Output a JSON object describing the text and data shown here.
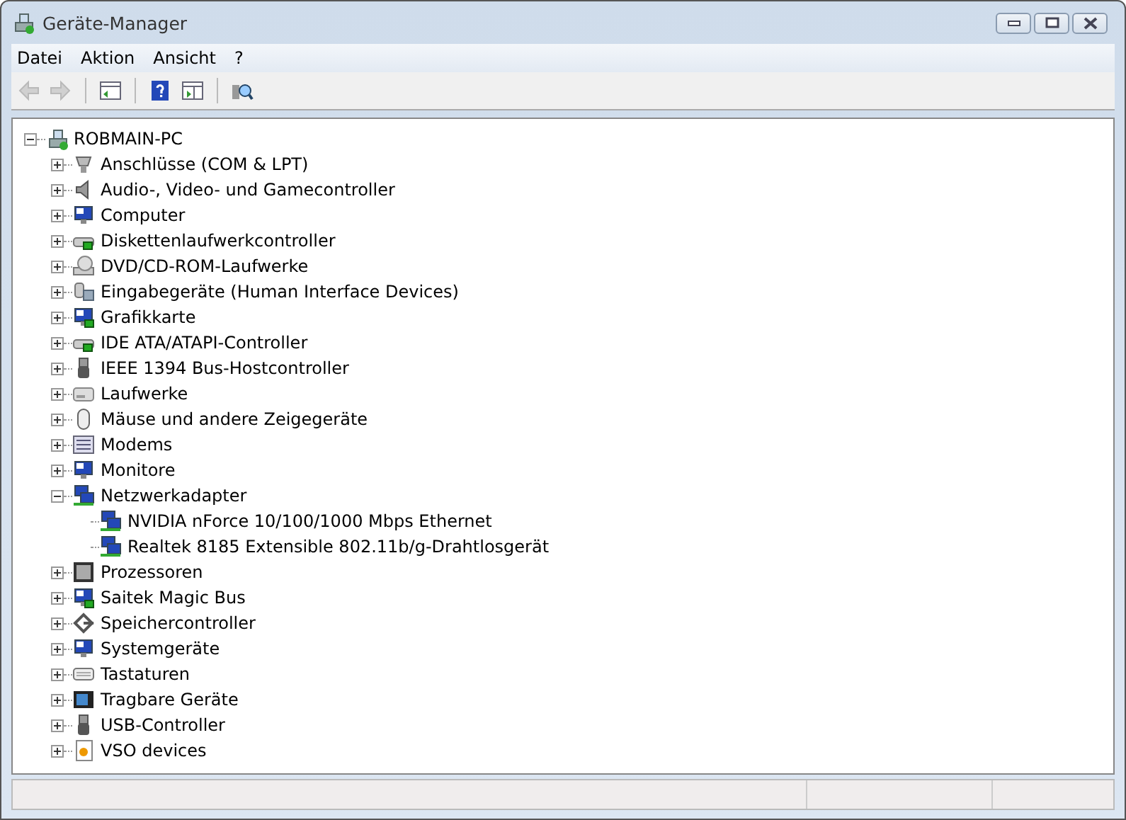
{
  "window": {
    "title": "Geräte-Manager"
  },
  "menu": [
    "Datei",
    "Aktion",
    "Ansicht",
    "?"
  ],
  "toolbar": [
    {
      "kind": "back",
      "disabled": true
    },
    {
      "kind": "forward",
      "disabled": true
    },
    {
      "kind": "sep"
    },
    {
      "kind": "tree",
      "disabled": false
    },
    {
      "kind": "sep"
    },
    {
      "kind": "help",
      "disabled": false
    },
    {
      "kind": "pane",
      "disabled": false
    },
    {
      "kind": "sep"
    },
    {
      "kind": "scan",
      "disabled": false
    }
  ],
  "tree": {
    "label": "ROBMAIN-PC",
    "kind": "pc",
    "expanded": true,
    "children": [
      {
        "label": "Anschlüsse (COM & LPT)",
        "kind": "port",
        "expanded": false
      },
      {
        "label": "Audio-, Video- und Gamecontroller",
        "kind": "audio",
        "expanded": false
      },
      {
        "label": "Computer",
        "kind": "computer",
        "expanded": false
      },
      {
        "label": "Diskettenlaufwerkcontroller",
        "kind": "floppy",
        "expanded": false
      },
      {
        "label": "DVD/CD-ROM-Laufwerke",
        "kind": "dvd",
        "expanded": false
      },
      {
        "label": "Eingabegeräte (Human Interface Devices)",
        "kind": "hid",
        "expanded": false
      },
      {
        "label": "Grafikkarte",
        "kind": "display",
        "expanded": false
      },
      {
        "label": "IDE ATA/ATAPI-Controller",
        "kind": "ide",
        "expanded": false
      },
      {
        "label": "IEEE 1394 Bus-Hostcontroller",
        "kind": "plug",
        "expanded": false
      },
      {
        "label": "Laufwerke",
        "kind": "drive",
        "expanded": false
      },
      {
        "label": "Mäuse und andere Zeigegeräte",
        "kind": "mouse",
        "expanded": false
      },
      {
        "label": "Modems",
        "kind": "modem",
        "expanded": false
      },
      {
        "label": "Monitore",
        "kind": "monitor",
        "expanded": false
      },
      {
        "label": "Netzwerkadapter",
        "kind": "network",
        "expanded": true,
        "children": [
          {
            "label": "NVIDIA nForce 10/100/1000 Mbps Ethernet",
            "kind": "network"
          },
          {
            "label": "Realtek 8185 Extensible 802.11b/g-Drahtlosgerät",
            "kind": "network"
          }
        ]
      },
      {
        "label": "Prozessoren",
        "kind": "cpu",
        "expanded": false
      },
      {
        "label": "Saitek Magic Bus",
        "kind": "display",
        "expanded": false
      },
      {
        "label": "Speichercontroller",
        "kind": "storage",
        "expanded": false
      },
      {
        "label": "Systemgeräte",
        "kind": "computer",
        "expanded": false
      },
      {
        "label": "Tastaturen",
        "kind": "keyboard",
        "expanded": false
      },
      {
        "label": "Tragbare Geräte",
        "kind": "portable",
        "expanded": false
      },
      {
        "label": "USB-Controller",
        "kind": "plug",
        "expanded": false
      },
      {
        "label": "VSO devices",
        "kind": "generic",
        "expanded": false
      }
    ]
  }
}
